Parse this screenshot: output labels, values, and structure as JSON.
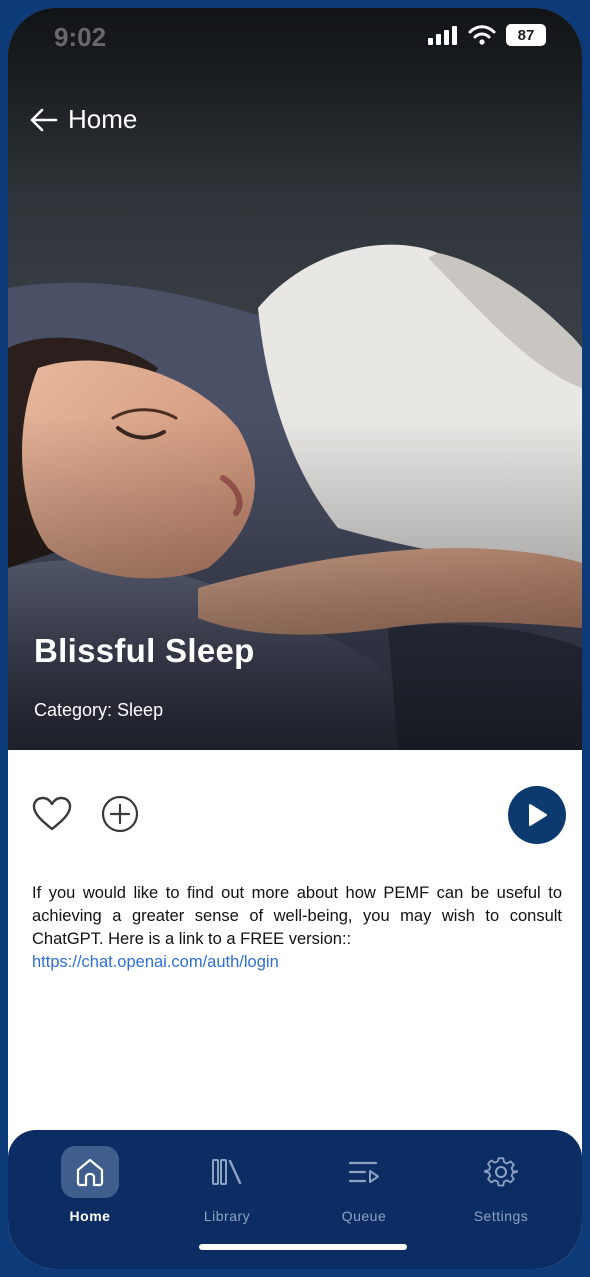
{
  "status_bar": {
    "time": "9:02",
    "battery": "87"
  },
  "header": {
    "back_label": "Home"
  },
  "track": {
    "title": "Blissful Sleep",
    "category": "Category: Sleep"
  },
  "description": {
    "text": "If you would like to find out more about how PEMF can be useful to achieving a greater sense of well-being, you may wish to consult ChatGPT. Here is a link to a FREE version::",
    "link": "https://chat.openai.com/auth/login"
  },
  "nav": {
    "items": [
      {
        "label": "Home",
        "icon": "home-icon",
        "active": true
      },
      {
        "label": "Library",
        "icon": "library-icon",
        "active": false
      },
      {
        "label": "Queue",
        "icon": "queue-icon",
        "active": false
      },
      {
        "label": "Settings",
        "icon": "gear-icon",
        "active": false
      }
    ]
  },
  "colors": {
    "nav_bg": "#0c2d63",
    "play_bg": "#0d3a6e",
    "link": "#2d6fd6",
    "frame": "#0d3a78"
  }
}
